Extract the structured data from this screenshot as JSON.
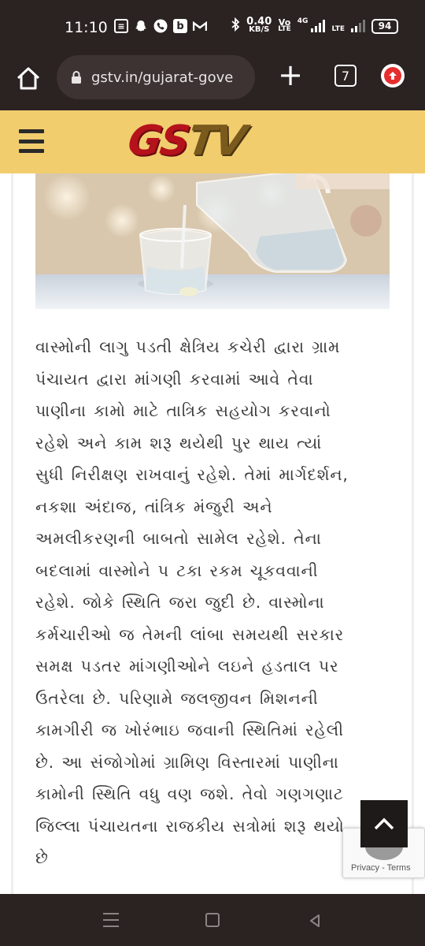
{
  "status_bar": {
    "time": "11:10",
    "notification_icons": [
      "message-icon",
      "snapchat-icon",
      "phone-icon",
      "b-app-icon",
      "gmail-icon"
    ],
    "b_app_letter": "b",
    "speed_value": "0.40",
    "speed_unit": "KB/S",
    "volte_top": "Vo",
    "volte_sub": "LTE",
    "volte_sub2": "LTE",
    "network_type": "4G",
    "battery": "94"
  },
  "browser": {
    "url": "gstv.in/gujarat-gove",
    "tab_count": "7",
    "new_tab_symbol": "+"
  },
  "site": {
    "logo_part1": "GS",
    "logo_part2": "TV",
    "brand_color": "#b5121b",
    "header_bg": "#f1cd6e"
  },
  "article": {
    "image_icon": "water-glass-pitcher-photo",
    "body": "વાસ્મોની લાગુ પડતી ક્ષેત્રિય કચેરી દ્વારા ગ્રામ પંચાયત દ્વારા માંગણી કરવામાં આવે તેવા પાણીના કામો માટે તાત્રિક સહયોગ કરવાનો રહેશે અને કામ શરૂ થયેથી પુર થાય ત્યાં સુધી નિરીક્ષણ રાખવાનું રહેશે. તેમાં માર્ગદર્શન, નકશા અંદાજ, તાંત્રિક મંજુરી અને અમલીકરણની બાબતો સામેલ રહેશે. તેના બદલામાં વાસ્મોને પ ટકા રકમ ચૂકવવાની રહેશે. જોકે સ્થિતિ જરા જુદી છે. વાસ્મોના કર્મચારીઓ જ તેમની લાંબા સમયથી સરકાર સમક્ષ પડતર માંગણીઓને લઇને હડતાલ પર ઉતરેલા છે. પરિણામે જલજીવન મિશનની કામગીરી જ ખોરંભાઇ જવાની સ્થિતિમાં રહેલી છે. આ સંજોગોમાં ગ્રામિણ વિસ્તારમાં પાણીના કામોની સ્થિતિ વધુ વણ જશે. તેવો ગણગણાટ જિલ્લા પંચાયતના રાજકીય સત્રોમાં શરૂ થયો છે"
  },
  "recaptcha": {
    "privacy": "Privacy",
    "separator": " - ",
    "terms": "Terms"
  },
  "nav": {
    "icons": [
      "recents-icon",
      "home-icon",
      "back-icon"
    ]
  }
}
